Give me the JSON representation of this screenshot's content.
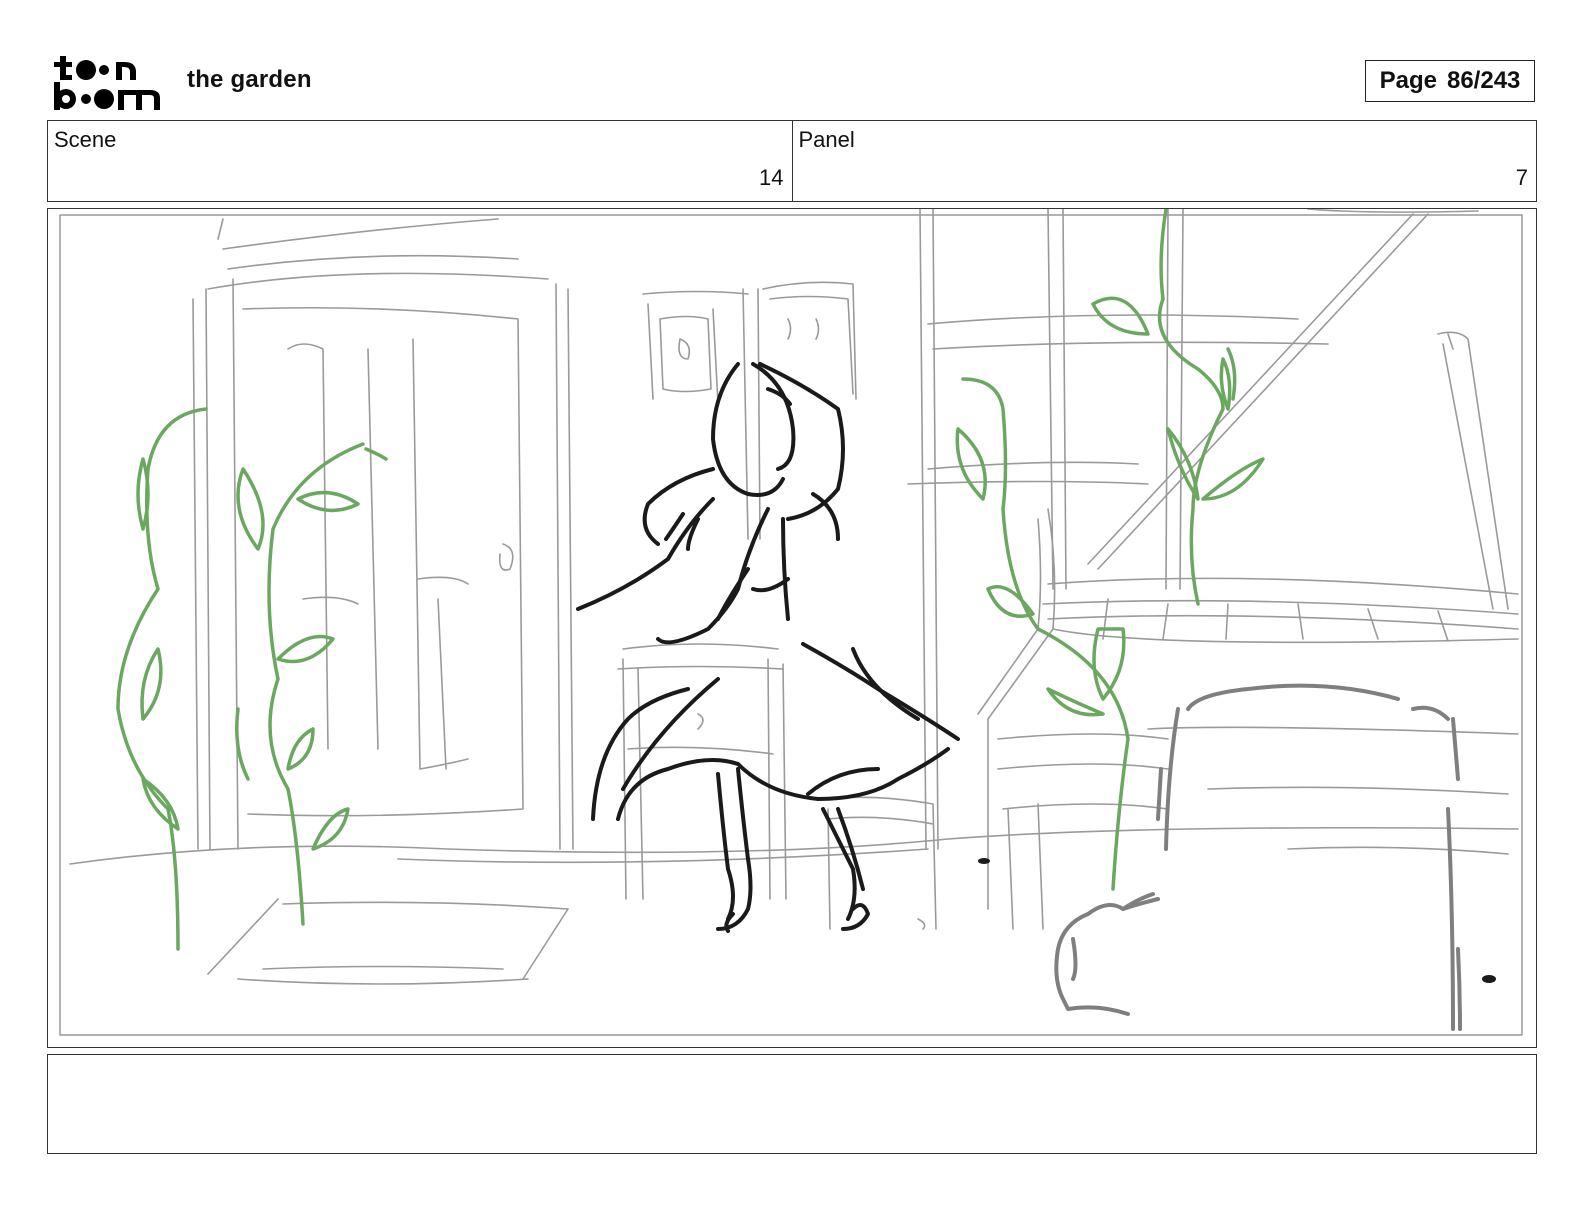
{
  "header": {
    "logo": {
      "line1": "toon",
      "line2": "boom"
    },
    "project_title": "the garden",
    "page_label": "Page",
    "page_number": "86/243"
  },
  "info": {
    "scene_label": "Scene",
    "scene_value": "14",
    "panel_label": "Panel",
    "panel_value": "7"
  },
  "notes": {
    "text": ""
  },
  "colors": {
    "sketch_gray": "#9a9a9a",
    "ink_black": "#1a1a1a",
    "vine_green": "#6aa860",
    "frame": "#333333"
  }
}
